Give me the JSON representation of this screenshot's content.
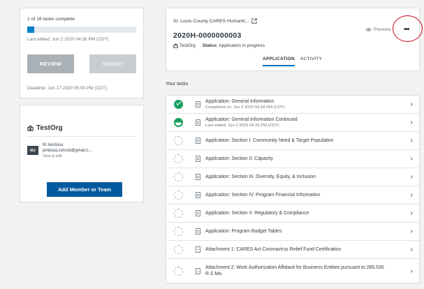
{
  "progress": {
    "summary": "1 of 16 tasks complete",
    "fraction_complete": 0.0625,
    "last_edited": "Last edited: Jun 2 2020 04:26 PM (CDT)",
    "review_label": "REVIEW",
    "submit_label": "SUBMIT",
    "deadline": "Deadline: Jun 17 2020 05:00 PM (CDT)"
  },
  "org": {
    "name": "TestOrg",
    "member_initials": "MJ",
    "member_name": "M Jendusa",
    "member_email": "jendusa.corosti@gmail.c...",
    "member_link": "View & edit",
    "add_button": "Add Member or Team"
  },
  "header": {
    "program_name": "St. Louis County CARES Humanit...",
    "preview_label": "Preview",
    "more_label": "•••",
    "app_id": "2020H-0000000003",
    "org_name": "TestOrg",
    "status_label": "Status:",
    "status_value": "Application in progress",
    "tabs": [
      "APPLICATION",
      "ACTIVITY"
    ]
  },
  "tasks_heading": "Your tasks",
  "tasks": [
    {
      "title": "Application: General Information",
      "sub": "Completed on: Jun 2 2020 04:18 PM (CDT)",
      "status": "complete"
    },
    {
      "title": "Application: General Information Continued",
      "sub": "Last edited: Jun 2 2020 04:26 PM (CDT)",
      "status": "in-progress"
    },
    {
      "title": "Application: Section I. Community Need & Target Population",
      "sub": "",
      "status": "not-started"
    },
    {
      "title": "Application: Section II. Capacity",
      "sub": "",
      "status": "not-started"
    },
    {
      "title": "Application: Section III. Diversity, Equity, & Inclusion",
      "sub": "",
      "status": "not-started"
    },
    {
      "title": "Application: Section IV. Program Financial Information",
      "sub": "",
      "status": "not-started"
    },
    {
      "title": "Application: Section V. Regulatory & Compliance",
      "sub": "",
      "status": "not-started"
    },
    {
      "title": "Application: Program Budget Tables",
      "sub": "",
      "status": "not-started"
    },
    {
      "title": "Attachment 1: CARES Act Coronavirus Relief Fund Certification",
      "sub": "",
      "status": "not-started"
    },
    {
      "title": "Attachment 2: Work Authorization Affidavit for Business Entities pursuant to 285.530 R.S.Mo.",
      "sub": "",
      "status": "not-started"
    }
  ],
  "colors": {
    "accent": "#0074c2",
    "button_blue": "#005b9e",
    "complete_green": "#18a05e",
    "annotation_red": "#d0021b"
  }
}
